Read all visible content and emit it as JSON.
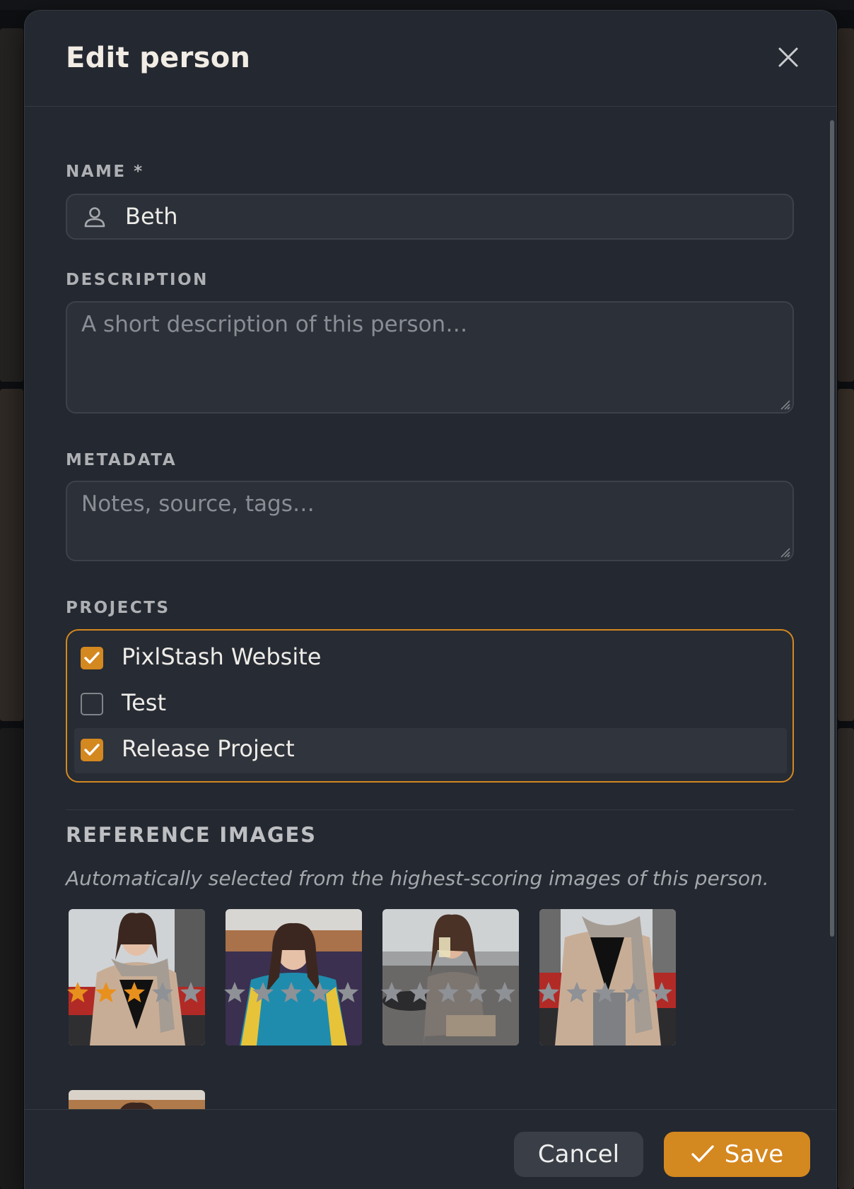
{
  "modal": {
    "title": "Edit person",
    "close_icon": "close-icon"
  },
  "form": {
    "name": {
      "label": "NAME *",
      "value": "Beth",
      "icon": "person-icon"
    },
    "description": {
      "label": "DESCRIPTION",
      "value": "",
      "placeholder": "A short description of this person…"
    },
    "metadata": {
      "label": "METADATA",
      "value": "",
      "placeholder": "Notes, source, tags…"
    },
    "projects": {
      "label": "PROJECTS",
      "items": [
        {
          "label": "PixlStash Website",
          "checked": true
        },
        {
          "label": "Test",
          "checked": false
        },
        {
          "label": "Release Project",
          "checked": true
        }
      ]
    }
  },
  "reference_images": {
    "title": "REFERENCE IMAGES",
    "description": "Automatically selected from the highest-scoring images of this person.",
    "images": [
      {
        "subject": "woman in beige coat with scarf",
        "rating": 3,
        "max_rating": 5
      },
      {
        "subject": "woman in blue and yellow track jacket",
        "rating": 0,
        "max_rating": 5
      },
      {
        "subject": "woman in grey tank top drinking at cafe",
        "rating": 0,
        "max_rating": 5
      },
      {
        "subject": "woman in beige coat with scarf, standing",
        "rating": 0,
        "max_rating": 5
      },
      {
        "subject": "woman portrait (partially visible)",
        "rating": null,
        "max_rating": 5
      }
    ]
  },
  "footer": {
    "cancel_label": "Cancel",
    "save_label": "Save",
    "save_icon": "check-icon"
  },
  "colors": {
    "accent": "#d48820",
    "modal_bg": "#242830",
    "field_bg": "#2c3038",
    "star_active": "#e8901e",
    "star_inactive": "#8e9196"
  }
}
